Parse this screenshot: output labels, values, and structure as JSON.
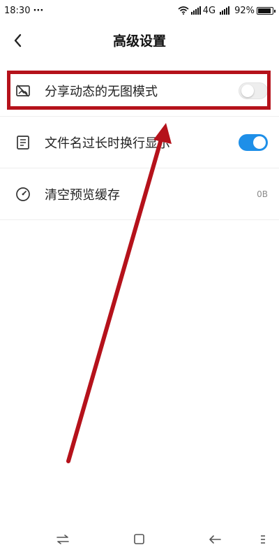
{
  "status_bar": {
    "time": "18:30",
    "dots": "···",
    "network": "4G",
    "battery_text": "92%",
    "battery_level": 0.92
  },
  "header": {
    "title": "高级设置"
  },
  "settings": {
    "items": [
      {
        "label": "分享动态的无图模式",
        "icon": "image-off-icon",
        "control": "toggle",
        "enabled": false
      },
      {
        "label": "文件名过长时换行显示",
        "icon": "document-icon",
        "control": "toggle",
        "enabled": true
      },
      {
        "label": "清空预览缓存",
        "icon": "gauge-icon",
        "control": "value",
        "value": "0B"
      }
    ]
  },
  "annotation": {
    "color": "#b5121b"
  },
  "colors": {
    "toggle_on": "#1e8fe8",
    "toggle_off": "#eeeeee"
  }
}
